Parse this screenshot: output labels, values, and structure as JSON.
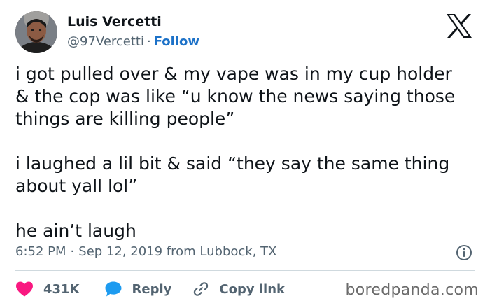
{
  "author": {
    "name": "Luis Vercetti",
    "handle": "@97Vercetti",
    "separator": "·",
    "follow_label": "Follow"
  },
  "tweet": {
    "paragraphs": [
      "i got pulled over & my vape was in my cup holder\n& the cop was like “u know the news saying those\nthings are killing people”",
      "i laughed a lil bit & said “they say the same thing\nabout yall lol”",
      "he ain’t laugh"
    ]
  },
  "meta": {
    "time": "6:52 PM",
    "separator": "·",
    "date_location": "Sep 12, 2019 from Lubbock, TX"
  },
  "actions": {
    "like_count": "431K",
    "reply_label": "Reply",
    "copy_link_label": "Copy link"
  },
  "watermark": "boredpanda.com",
  "colors": {
    "like": "#f91880",
    "reply": "#1d9bf0",
    "follow": "#1d72c8",
    "secondary_text": "#536471"
  },
  "icons": [
    "x-logo-icon",
    "info-icon",
    "heart-icon",
    "reply-bubble-icon",
    "link-icon"
  ]
}
